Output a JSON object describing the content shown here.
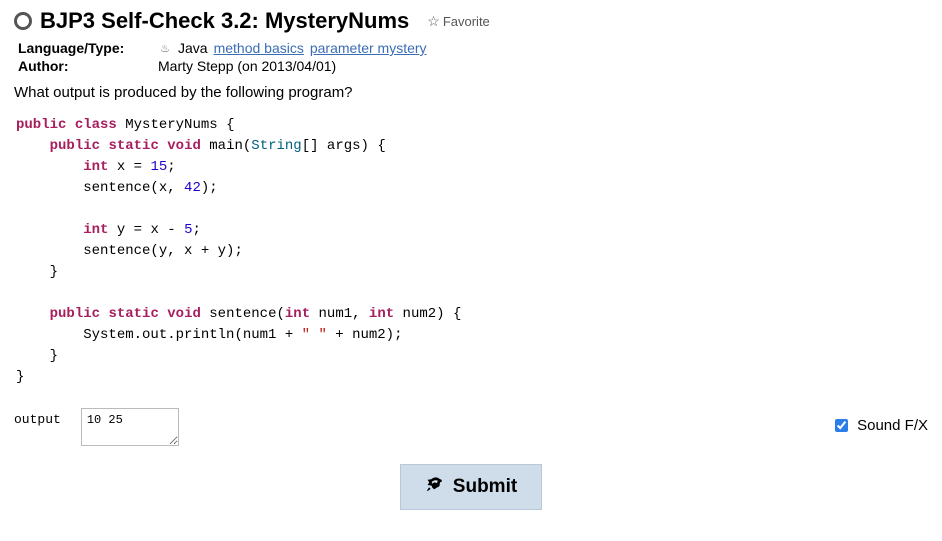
{
  "title": "BJP3 Self-Check 3.2: MysteryNums",
  "favorite_label": "Favorite",
  "meta": {
    "language_label": "Language/Type:",
    "language_value": "Java",
    "tags": [
      "method basics",
      "parameter mystery"
    ],
    "author_label": "Author:",
    "author_value": "Marty Stepp (on 2013/04/01)"
  },
  "prompt": "What output is produced by the following program?",
  "code": {
    "line1_kw1": "public",
    "line1_kw2": "class",
    "line1_cls": "MysteryNums",
    "line1_end": " {",
    "line2_kw1": "public",
    "line2_kw2": "static",
    "line2_kw3": "void",
    "line2_main": " main(",
    "line2_type": "String",
    "line2_rest": "[] args) {",
    "line3_kw": "int",
    "line3_rest": " x = ",
    "line3_num": "15",
    "line3_end": ";",
    "line4": "sentence(x, ",
    "line4_num": "42",
    "line4_end": ");",
    "line6_kw": "int",
    "line6_rest": " y = x - ",
    "line6_num": "5",
    "line6_end": ";",
    "line7": "sentence(y, x + y);",
    "line8": "}",
    "line10_kw1": "public",
    "line10_kw2": "static",
    "line10_kw3": "void",
    "line10_name": " sentence(",
    "line10_type1": "int",
    "line10_p1": " num1, ",
    "line10_type2": "int",
    "line10_p2": " num2) {",
    "line11_a": "System.out.println(num1 + ",
    "line11_str": "\" \"",
    "line11_b": " + num2);",
    "line12": "}",
    "line13": "}"
  },
  "answer": {
    "label": "output",
    "value": "10 25"
  },
  "sound_label": "Sound F/X",
  "submit_label": "Submit"
}
